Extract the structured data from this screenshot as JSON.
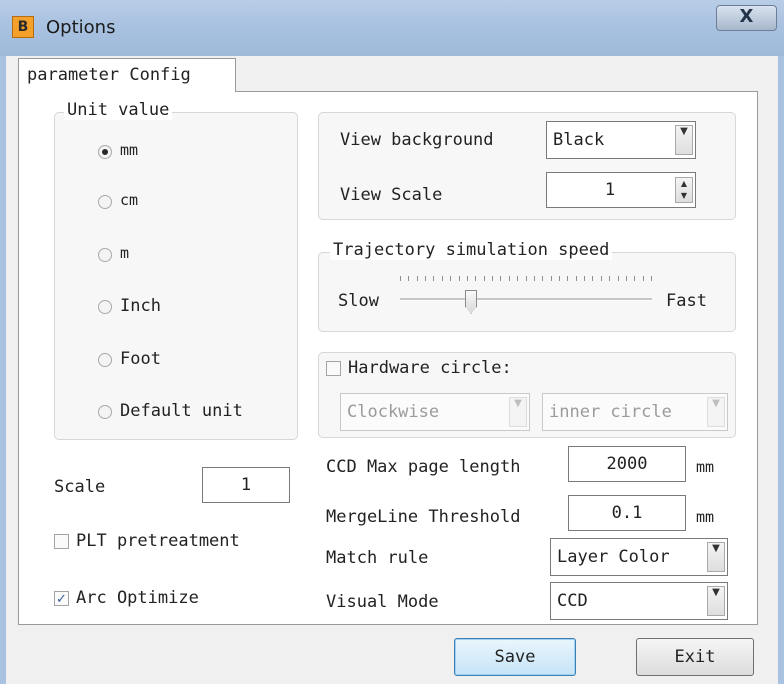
{
  "window": {
    "title": "Options",
    "app_icon_letter": "B",
    "close_glyph": "X"
  },
  "tabs": [
    {
      "label": "parameter Config",
      "active": true
    }
  ],
  "unit_group": {
    "legend": "Unit value",
    "options": [
      {
        "label": "mm",
        "selected": true
      },
      {
        "label": "cm",
        "selected": false
      },
      {
        "label": "m",
        "selected": false
      },
      {
        "label": "Inch",
        "selected": false
      },
      {
        "label": "Foot",
        "selected": false
      },
      {
        "label": "Default unit",
        "selected": false
      }
    ]
  },
  "view": {
    "background_label": "View background",
    "background_value": "Black",
    "scale_label": "View Scale",
    "scale_value": "1"
  },
  "speed": {
    "legend": "Trajectory simulation speed",
    "min_label": "Slow",
    "max_label": "Fast",
    "level": 0.28
  },
  "hardware_circle": {
    "label": "Hardware circle:",
    "checked": false,
    "direction_value": "Clockwise",
    "mode_value": "inner circle"
  },
  "bottom_left": {
    "scale_label": "Scale",
    "scale_value": "1",
    "plt_label": "PLT pretreatment",
    "plt_checked": false,
    "arc_label": "Arc Optimize",
    "arc_checked": true
  },
  "settings": {
    "ccd_label": "CCD Max page length",
    "ccd_value": "2000",
    "ccd_unit": "mm",
    "merge_label": "MergeLine Threshold",
    "merge_value": "0.1",
    "merge_unit": "mm",
    "match_label": "Match rule",
    "match_value": "Layer Color",
    "visual_label": "Visual Mode",
    "visual_value": "CCD"
  },
  "buttons": {
    "save": "Save",
    "exit": "Exit"
  },
  "icons": {
    "dropdown": "chevron-down-icon",
    "spin": "spin-updown-icon",
    "check": "✓"
  },
  "colors": {
    "titlebar": "#a9c2e1",
    "client": "#f0f0f0",
    "app_icon": "#f3a12b"
  }
}
